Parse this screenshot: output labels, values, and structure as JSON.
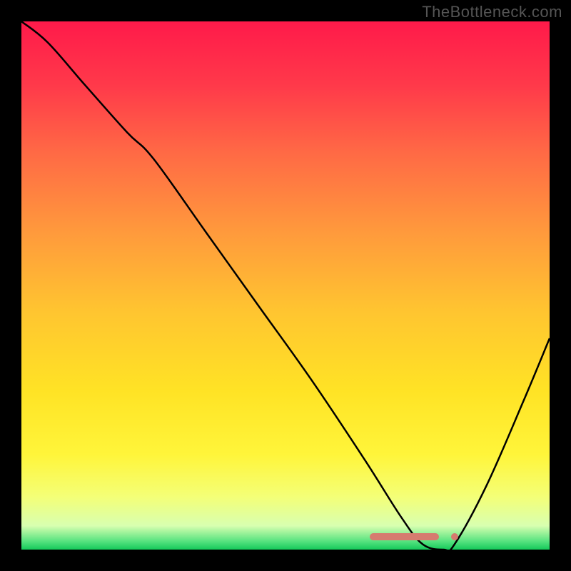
{
  "watermark": "TheBottleneck.com",
  "chart_data": {
    "type": "line",
    "title": "",
    "xlabel": "",
    "ylabel": "",
    "xlim": [
      0,
      100
    ],
    "ylim": [
      0,
      100
    ],
    "background": {
      "type": "vertical-gradient",
      "stops": [
        {
          "pos": 0.0,
          "color": "#ff1a4a"
        },
        {
          "pos": 0.12,
          "color": "#ff394a"
        },
        {
          "pos": 0.25,
          "color": "#ff6a45"
        },
        {
          "pos": 0.4,
          "color": "#ff9a3c"
        },
        {
          "pos": 0.55,
          "color": "#ffc530"
        },
        {
          "pos": 0.7,
          "color": "#ffe325"
        },
        {
          "pos": 0.82,
          "color": "#fff53a"
        },
        {
          "pos": 0.9,
          "color": "#f4ff77"
        },
        {
          "pos": 0.955,
          "color": "#d8ffb0"
        },
        {
          "pos": 0.985,
          "color": "#53e27e"
        },
        {
          "pos": 1.0,
          "color": "#15c95a"
        }
      ]
    },
    "series": [
      {
        "name": "bottleneck-curve",
        "color": "#000000",
        "x": [
          0,
          5,
          12,
          20,
          25,
          35,
          45,
          55,
          65,
          72,
          76,
          80,
          82,
          88,
          95,
          100
        ],
        "y": [
          100,
          96,
          88,
          79,
          74,
          60,
          46,
          32,
          17,
          6,
          1,
          0,
          1,
          12,
          28,
          40
        ]
      }
    ],
    "markers": {
      "name": "optimal-range",
      "color": "#d67b6f",
      "y": 2.5,
      "x_start": 66,
      "x_end": 79,
      "dot_x": 82
    }
  }
}
